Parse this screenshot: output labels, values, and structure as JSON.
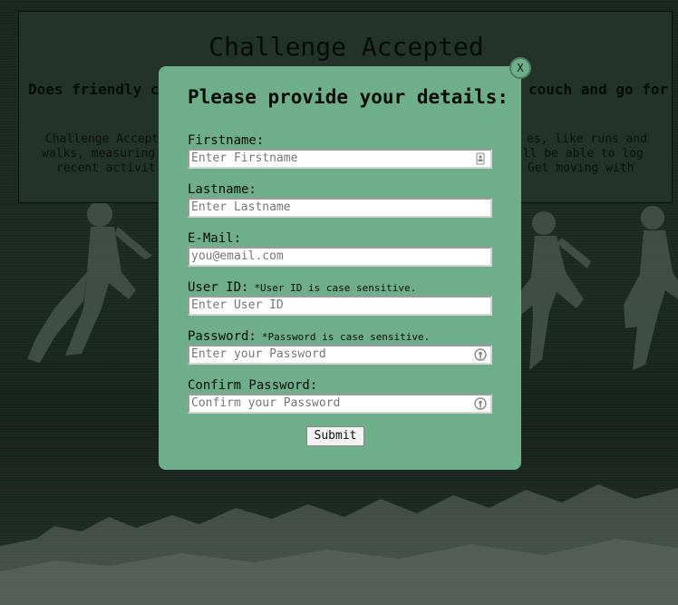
{
  "background": {
    "title": "Challenge Accepted",
    "lead_left": "Does friendly co",
    "lead_right": "couch and go for",
    "body_left_lines": [
      "Challenge Accept",
      "walks, measuring",
      "recent activit"
    ],
    "body_right_lines": [
      "es, like runs and",
      "'ll be able to log",
      "Get moving with"
    ]
  },
  "modal": {
    "close_label": "X",
    "title": "Please provide your details:",
    "fields": [
      {
        "label": "Firstname:",
        "note": "",
        "placeholder": "Enter Firstname",
        "icon": "contact-card-icon"
      },
      {
        "label": "Lastname:",
        "note": "",
        "placeholder": "Enter Lastname",
        "icon": ""
      },
      {
        "label": "E-Mail:",
        "note": "",
        "placeholder": "you@email.com",
        "icon": ""
      },
      {
        "label": "User ID:",
        "note": "*User ID is case sensitive.",
        "placeholder": "Enter User ID",
        "icon": ""
      },
      {
        "label": "Password:",
        "note": "*Password is case sensitive.",
        "placeholder": "Enter your Password",
        "icon": "password-manager-icon"
      },
      {
        "label": "Confirm Password:",
        "note": "",
        "placeholder": "Confirm your Password",
        "icon": "password-manager-icon"
      }
    ],
    "submit_label": "Submit"
  },
  "colors": {
    "modal_bg": "#6fae8a",
    "page_bg": "#1f2f27"
  }
}
